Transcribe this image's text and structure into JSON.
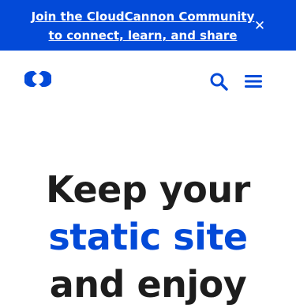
{
  "banner": {
    "line1": "Join the CloudCannon Community",
    "line2": "to connect, learn, and share",
    "close_glyph": "✕",
    "background_color": "#034ad8"
  },
  "header": {
    "logo_icon": "cloudcannon-logo-icon",
    "search_icon": "search-icon",
    "menu_icon": "hamburger-menu-icon",
    "accent_color": "#034ad8"
  },
  "hero": {
    "line1": "Keep your",
    "line2": "static site",
    "line3": "and enjoy"
  }
}
